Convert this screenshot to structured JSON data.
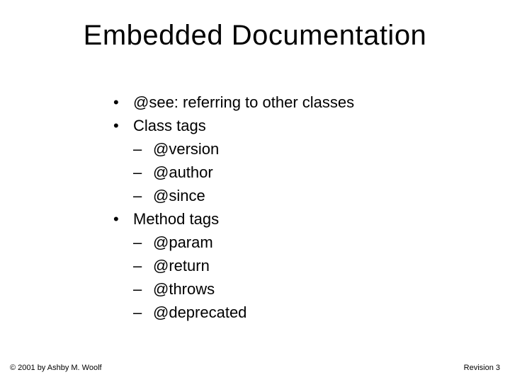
{
  "title": "Embedded Documentation",
  "bullets": {
    "b0": "@see: referring to other classes",
    "b1": "Class tags",
    "b1s0": "@version",
    "b1s1": "@author",
    "b1s2": "@since",
    "b2": "Method tags",
    "b2s0": "@param",
    "b2s1": "@return",
    "b2s2": "@throws",
    "b2s3": "@deprecated"
  },
  "marks": {
    "dot": "•",
    "dash": "–"
  },
  "footer": {
    "left": "© 2001 by Ashby M. Woolf",
    "right": "Revision 3"
  }
}
